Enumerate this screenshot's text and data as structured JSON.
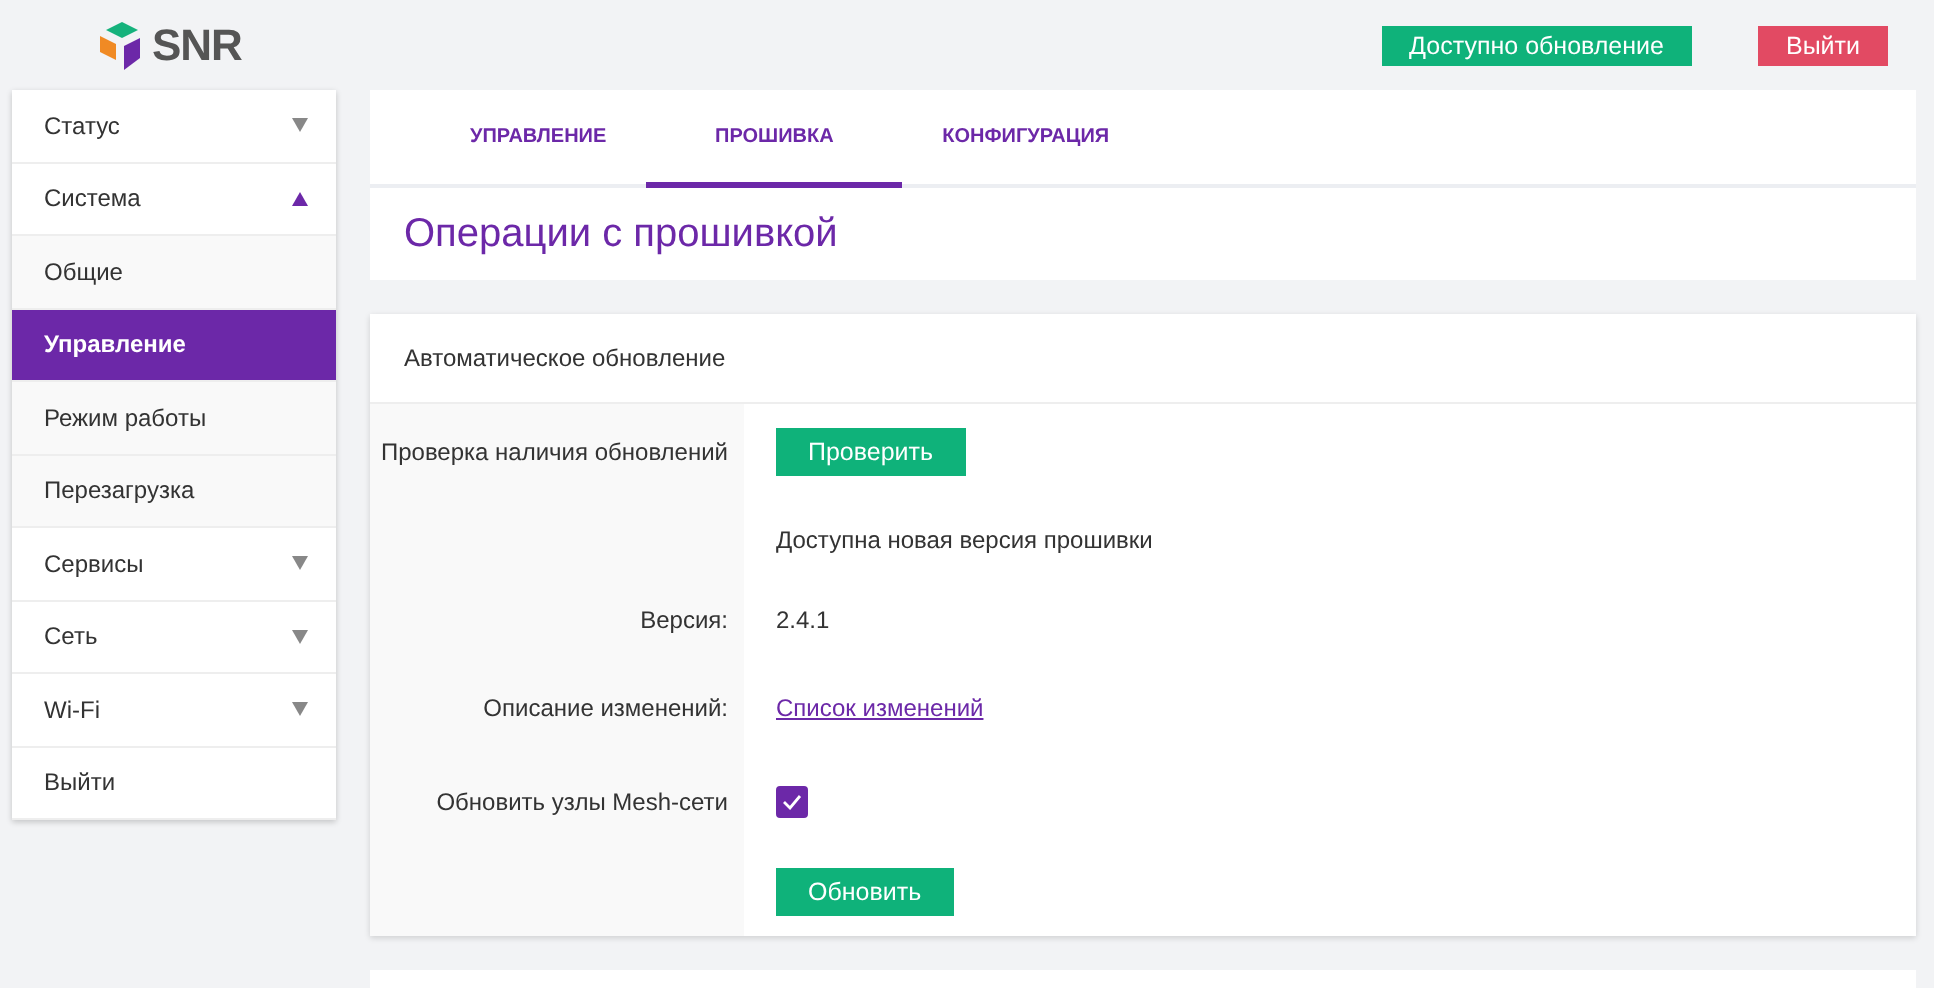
{
  "header": {
    "logo": "SNR",
    "update_button": "Доступно обновление",
    "logout_button": "Выйти"
  },
  "sidebar": {
    "items": [
      {
        "label": "Статус",
        "expanded": false,
        "selected": false
      },
      {
        "label": "Система",
        "expanded": true,
        "selected": false,
        "children": [
          {
            "label": "Общие",
            "selected": false
          },
          {
            "label": "Управление",
            "selected": true
          },
          {
            "label": "Режим работы",
            "selected": false
          },
          {
            "label": "Перезагрузка",
            "selected": false
          }
        ]
      },
      {
        "label": "Сервисы",
        "expanded": false,
        "selected": false
      },
      {
        "label": "Сеть",
        "expanded": false,
        "selected": false
      },
      {
        "label": "Wi-Fi",
        "expanded": false,
        "selected": false
      },
      {
        "label": "Выйти",
        "selected": false
      }
    ]
  },
  "tabs": [
    {
      "label": "УПРАВЛЕНИЕ",
      "selected": false
    },
    {
      "label": "ПРОШИВКА",
      "selected": true
    },
    {
      "label": "КОНФИГУРАЦИЯ",
      "selected": false
    }
  ],
  "page_title": "Операции с прошивкой",
  "card": {
    "title": "Автоматическое обновление",
    "rows": [
      {
        "kind": "button",
        "label": "Проверка наличия обновлений",
        "value": "Проверить"
      },
      {
        "kind": "text",
        "value": "Доступна новая версия прошивки"
      },
      {
        "kind": "text",
        "label": "Версия:",
        "value": "2.4.1"
      },
      {
        "kind": "link",
        "label": "Описание изменений:",
        "value": "Список изменений"
      },
      {
        "kind": "checkbox",
        "label": "Обновить узлы Mesh-сети",
        "checked": true
      },
      {
        "kind": "button",
        "value": "Обновить"
      }
    ]
  }
}
